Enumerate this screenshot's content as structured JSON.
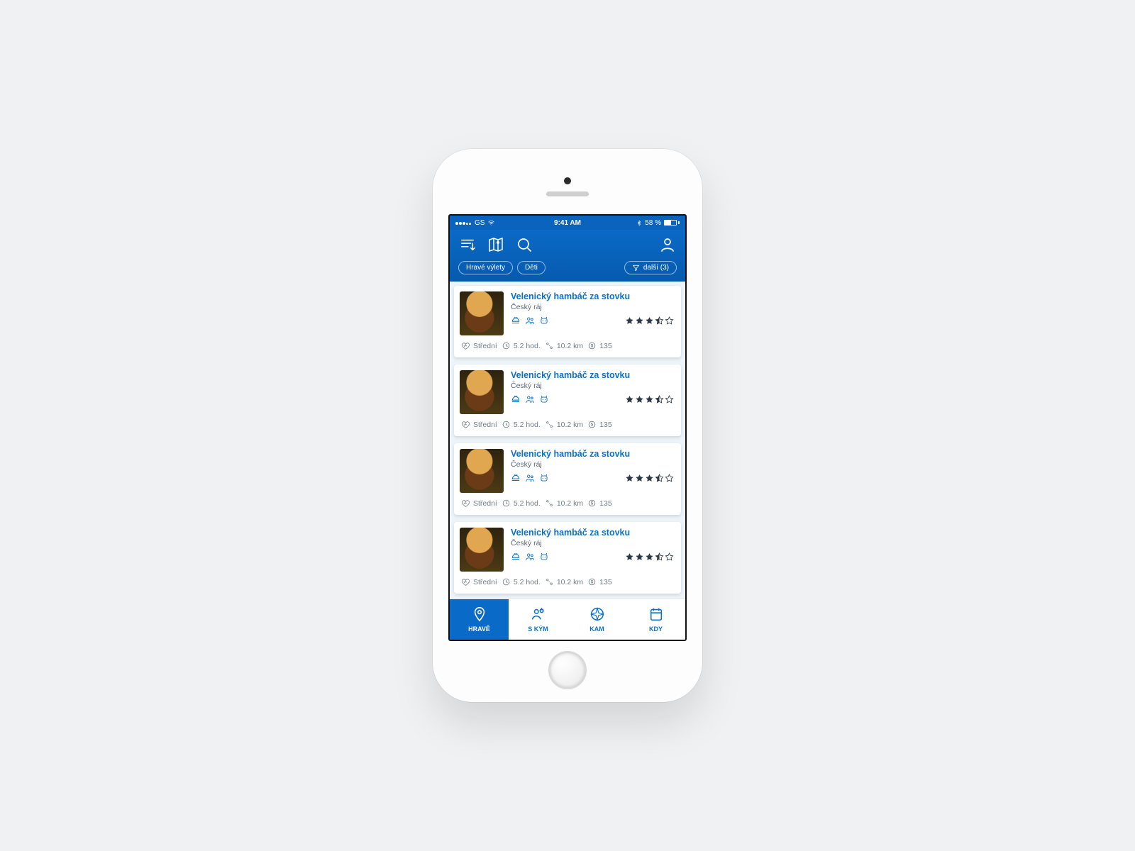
{
  "status": {
    "carrier": "GS",
    "time": "9:41 AM",
    "battery": "58 %",
    "bluetooth": true
  },
  "toolbar": {
    "icons": [
      "sort-icon",
      "map-icon",
      "search-icon",
      "profile-icon"
    ]
  },
  "chips": {
    "items": [
      {
        "label": "Hravé výlety"
      },
      {
        "label": "Děti"
      }
    ],
    "filter_label": "další (3)"
  },
  "cards": [
    {
      "title": "Velenický hambáč za stovku",
      "region": "Český ráj",
      "difficulty": "Střední",
      "duration": "5.2 hod.",
      "distance": "10.2 km",
      "price": "135",
      "rating": 3.5
    },
    {
      "title": "Velenický hambáč za stovku",
      "region": "Český ráj",
      "difficulty": "Střední",
      "duration": "5.2 hod.",
      "distance": "10.2 km",
      "price": "135",
      "rating": 3.5
    },
    {
      "title": "Velenický hambáč za stovku",
      "region": "Český ráj",
      "difficulty": "Střední",
      "duration": "5.2 hod.",
      "distance": "10.2 km",
      "price": "135",
      "rating": 3.5
    },
    {
      "title": "Velenický hambáč za stovku",
      "region": "Český ráj",
      "difficulty": "Střední",
      "duration": "5.2 hod.",
      "distance": "10.2 km",
      "price": "135",
      "rating": 3.5
    }
  ],
  "tabs": [
    {
      "label": "HRAVĚ",
      "active": true
    },
    {
      "label": "S KÝM",
      "active": false
    },
    {
      "label": "KAM",
      "active": false
    },
    {
      "label": "KDY",
      "active": false
    }
  ]
}
